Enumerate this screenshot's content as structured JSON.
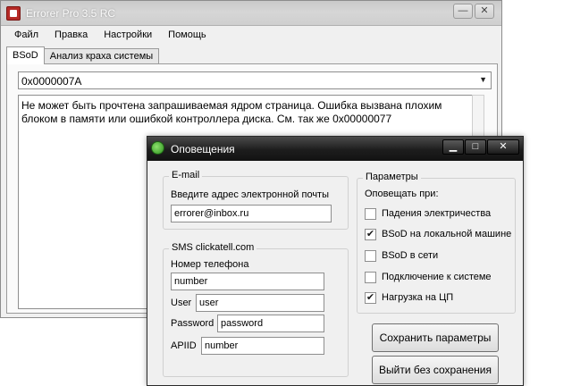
{
  "main_window": {
    "title": "Errorer Pro 3.5 RC",
    "controls": {
      "minimize": "—",
      "close": "✕"
    }
  },
  "menu": [
    "Файл",
    "Правка",
    "Настройки",
    "Помощь"
  ],
  "tabs": [
    "BSoD",
    "Анализ краха системы"
  ],
  "error_code": "0x0000007A",
  "error_description": "Не может быть прочтена запрашиваемая ядром страница. Ошибка вызвана плохим блоком в памяти или ошибкой контроллера диска. См. так же 0x00000077",
  "popup": {
    "title": "Оповещения",
    "controls": {
      "minimize": "▁",
      "maximize": "□",
      "close": "✕"
    },
    "email": {
      "legend": "E-mail",
      "label": "Введите адрес электронной почты",
      "value": "errorer@inbox.ru"
    },
    "sms": {
      "legend": "SMS clickatell.com",
      "phone_label": "Номер телефона",
      "phone_value": "number",
      "user_label": "User",
      "user_value": "user",
      "password_label": "Password",
      "password_value": "password",
      "apiid_label": "APIID",
      "apiid_value": "number"
    },
    "params": {
      "legend": "Параметры",
      "notify_label": "Оповещать при:",
      "options": [
        {
          "label": "Падения электричества",
          "checked": false
        },
        {
          "label": "BSoD на локальной машине",
          "checked": true
        },
        {
          "label": "BSoD в сети",
          "checked": false
        },
        {
          "label": "Подключение к системе",
          "checked": false
        },
        {
          "label": "Нагрузка на ЦП",
          "checked": true
        }
      ]
    },
    "save_button": "Сохранить параметры",
    "exit_button": "Выйти без сохранения"
  }
}
